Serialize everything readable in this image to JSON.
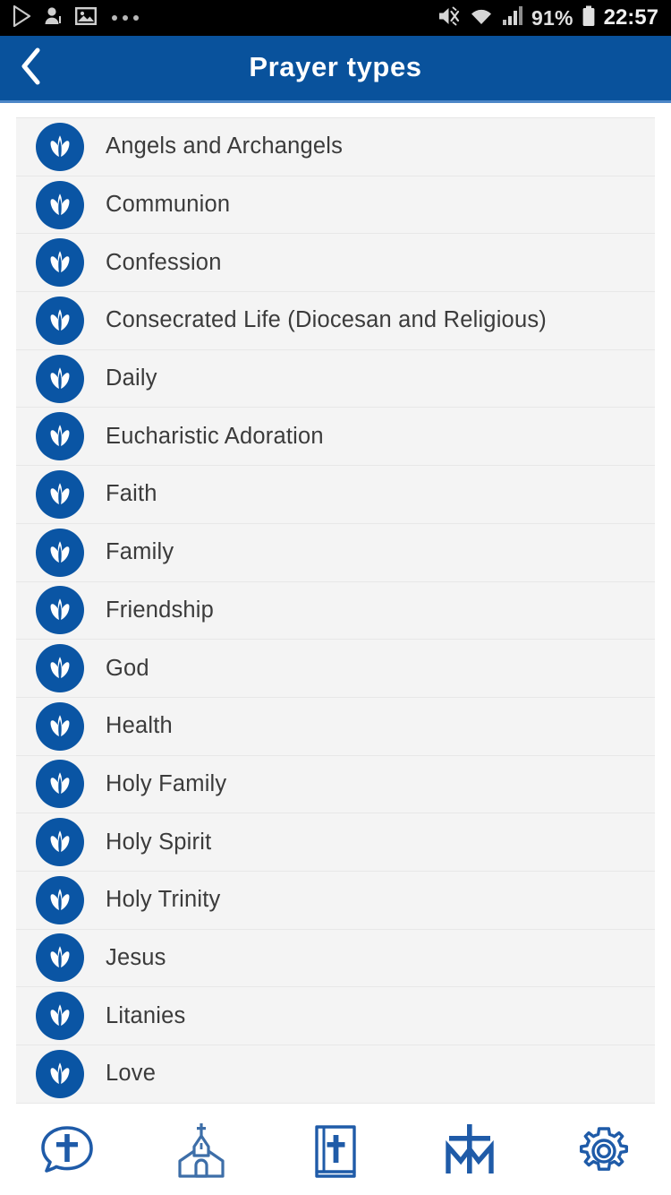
{
  "status_bar": {
    "left_icons": [
      "play-store-icon",
      "contact-add-icon",
      "photo-icon",
      "more-dots-icon"
    ],
    "right_icons": [
      "mute-icon",
      "wifi-icon",
      "cellular-signal-icon",
      "battery-icon"
    ],
    "battery_percent": "91%",
    "clock": "22:57",
    "background": "#000000"
  },
  "app_bar": {
    "title": "Prayer types",
    "back_icon": "chevron-left-icon",
    "background": "#09529c",
    "text_color": "#ffffff"
  },
  "list": {
    "item_icon": "praying-hands-icon",
    "icon_background": "#0a55a4",
    "row_background": "#f4f4f4",
    "items": [
      {
        "label": "Angels and Archangels"
      },
      {
        "label": "Communion"
      },
      {
        "label": "Confession"
      },
      {
        "label": "Consecrated Life (Diocesan and Religious)"
      },
      {
        "label": "Daily"
      },
      {
        "label": "Eucharistic Adoration"
      },
      {
        "label": "Faith"
      },
      {
        "label": "Family"
      },
      {
        "label": "Friendship"
      },
      {
        "label": "God"
      },
      {
        "label": "Health"
      },
      {
        "label": "Holy Family"
      },
      {
        "label": "Holy Spirit"
      },
      {
        "label": "Holy Trinity"
      },
      {
        "label": "Jesus"
      },
      {
        "label": "Litanies"
      },
      {
        "label": "Love"
      }
    ]
  },
  "bottom_nav": {
    "accent": "#1f5ba8",
    "items": [
      {
        "name": "prayer-bubble",
        "icon": "speech-bubble-cross-icon"
      },
      {
        "name": "church",
        "icon": "church-icon"
      },
      {
        "name": "bible",
        "icon": "bible-cross-icon"
      },
      {
        "name": "marian-cross",
        "icon": "marian-cross-icon"
      },
      {
        "name": "settings",
        "icon": "gear-icon"
      }
    ]
  }
}
